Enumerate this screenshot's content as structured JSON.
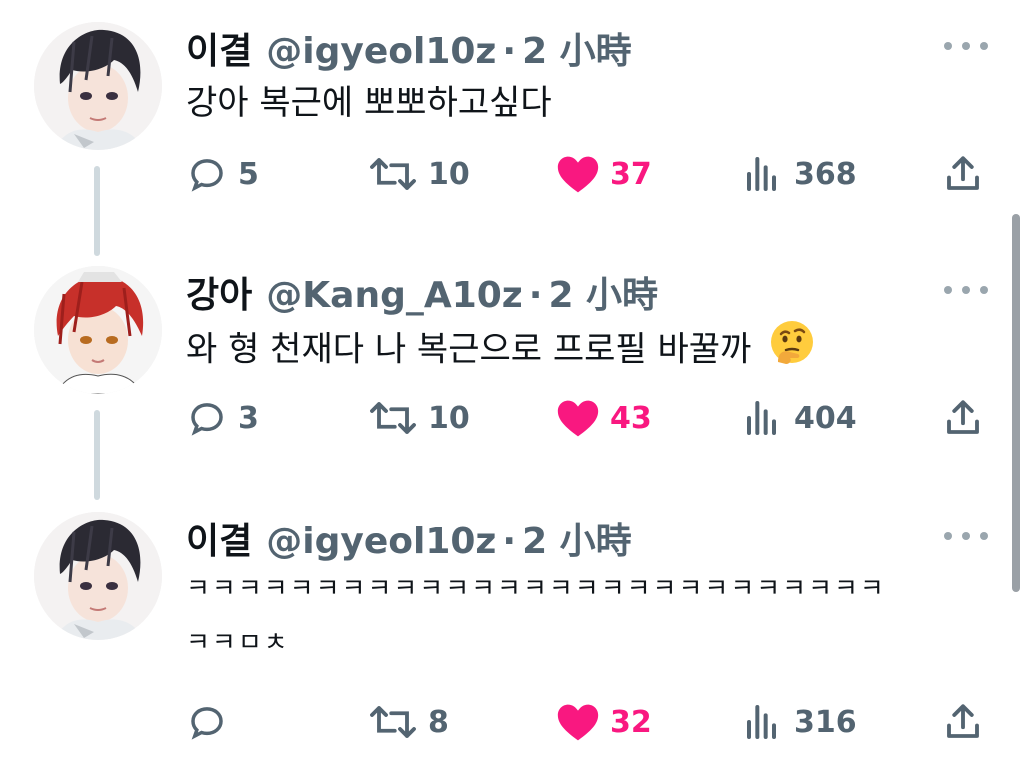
{
  "tweets": [
    {
      "name": "이결",
      "handle": "@igyeol10z",
      "dot": "·",
      "time": "2 小時",
      "text": "강아 복근에 뽀뽀하고싶다",
      "replies": "5",
      "retweets": "10",
      "likes": "37",
      "views": "368",
      "avatar": "dark-haired-boy"
    },
    {
      "name": "강아",
      "handle": "@Kang_A10z",
      "dot": "·",
      "time": "2 小時",
      "text": "와 형 천재다 나 복근으로 프로필 바꿀까",
      "emoji": "thinking-face",
      "replies": "3",
      "retweets": "10",
      "likes": "43",
      "views": "404",
      "avatar": "red-haired-boy"
    },
    {
      "name": "이결",
      "handle": "@igyeol10z",
      "dot": "·",
      "time": "2 小時",
      "text_line1": "ㅋㅋㅋㅋㅋㅋㅋㅋㅋㅋㅋㅋㅋㅋㅋㅋㅋㅋㅋㅋㅋㅋㅋㅋㅋㅋㅋ",
      "text_line2": "ㅋㅋㅁㅊ",
      "replies": "",
      "retweets": "8",
      "likes": "32",
      "views": "316",
      "avatar": "dark-haired-boy"
    }
  ],
  "colors": {
    "like": "#f91880",
    "muted": "#536471",
    "text": "#0f1419",
    "thread": "#cfd9de"
  },
  "icons": [
    "reply-icon",
    "retweet-icon",
    "like-icon",
    "views-icon",
    "share-icon",
    "more-icon"
  ]
}
